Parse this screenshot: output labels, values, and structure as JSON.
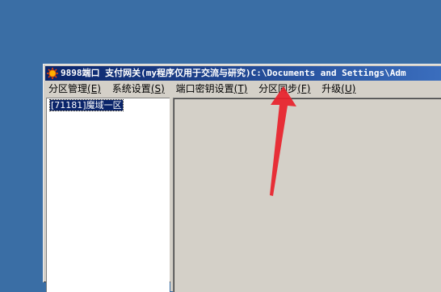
{
  "window": {
    "title": "9898端口 支付网关(my程序仅用于交流与研究)C:\\Documents and Settings\\Adm"
  },
  "menubar": {
    "items": [
      {
        "label": "分区管理",
        "accel": "(E)"
      },
      {
        "label": "系统设置",
        "accel": "(S)"
      },
      {
        "label": "端口密钥设置",
        "accel": "(T)"
      },
      {
        "label": "分区同步",
        "accel": "(F)"
      },
      {
        "label": "升级",
        "accel": "(U)"
      }
    ]
  },
  "tree": {
    "items": [
      {
        "label": "[71181]魔域一区",
        "selected": true
      }
    ]
  },
  "icons": {
    "app": "gear-sun-icon"
  },
  "colors": {
    "desktop": "#3a6ea5",
    "titlebar_start": "#0a246a",
    "titlebar_end": "#3b6fbf",
    "selection": "#0a246a",
    "annotation_arrow": "#e8202a"
  }
}
